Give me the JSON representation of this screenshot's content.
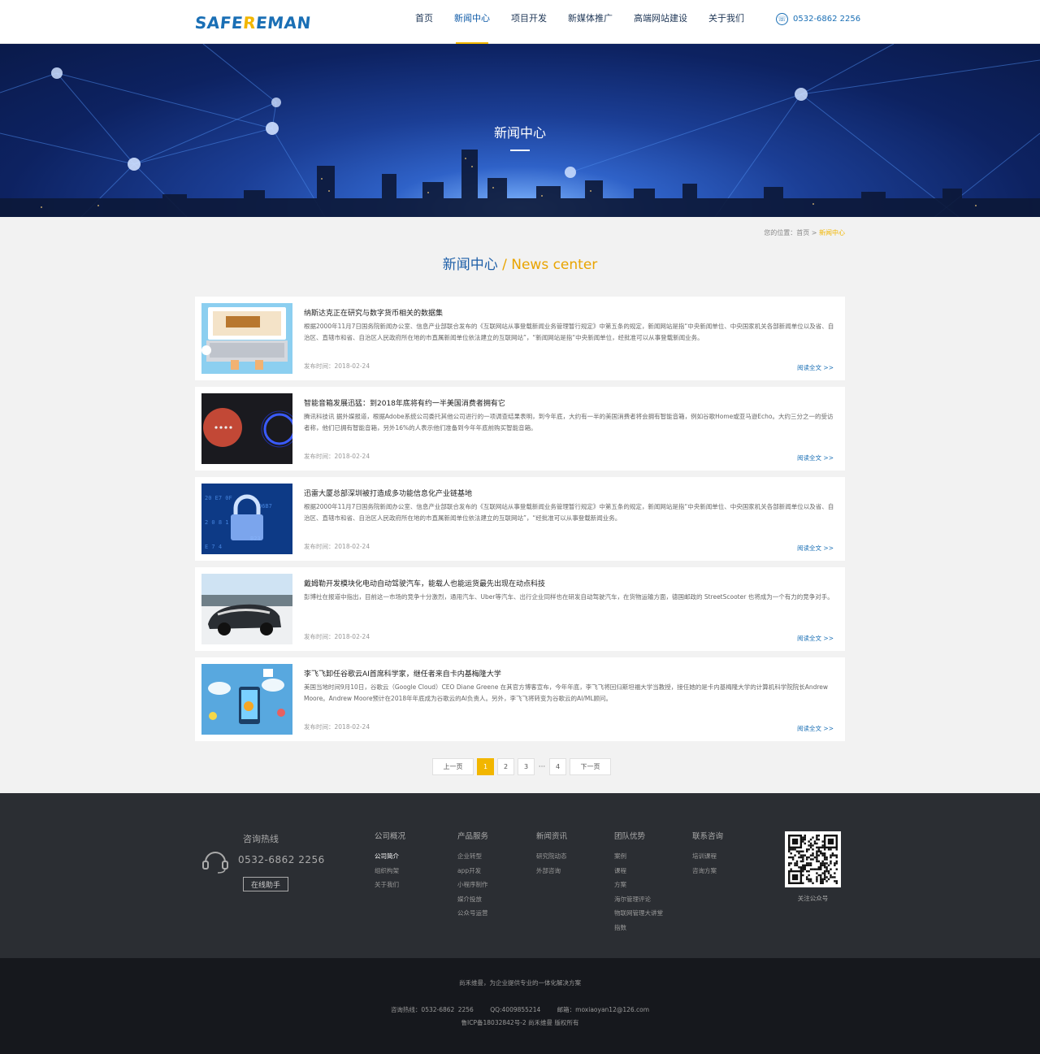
{
  "header": {
    "logo_left": "SAFE",
    "logo_key": "R",
    "logo_right": "EMAN",
    "nav": [
      "首页",
      "新闻中心",
      "项目开发",
      "新媒体推广",
      "高端网站建设",
      "关于我们"
    ],
    "active_nav": 1,
    "phone": "0532-6862 2256"
  },
  "banner": {
    "title": "新闻中心"
  },
  "breadcrumb": {
    "prefix": "您的位置：",
    "home": "首页",
    "sep": " > ",
    "current": "新闻中心"
  },
  "section": {
    "title_cn": "新闻中心",
    "sep": " / ",
    "title_en": "News center"
  },
  "news": [
    {
      "title": "纳斯达克正在研究与数字货币相关的数据集",
      "summary": "根据2000年11月7日国务院新闻办公室、信息产业部联合发布的《互联网站从事登载新闻业务管理暂行规定》中第五条的规定，新闻网站是指“中央新闻单位、中央国家机关各部新闻单位以及省、自治区、直辖市和省、自治区人民政府所在地的市直属新闻单位依法建立的互联网站”，“新闻网站是指“中央新闻单位，经批准可以从事登载新闻业务。",
      "date": "发布时间：2018-02-24",
      "more": "阅读全文 >>",
      "thumb": "laptop"
    },
    {
      "title": "智能音箱发展迅猛：到2018年底将有约一半美国消费者拥有它",
      "summary": "腾讯科技讯 据外媒报道，根据Adobe系统公司委托其他公司进行的一项调查结果表明，到今年底，大约有一半的美国消费者将会拥有智能音箱，例如谷歌Home或亚马逊Echo。大约三分之一的受访者称，他们已拥有智能音箱，另外16%的人表示他们准备到今年年底前购买智能音箱。",
      "date": "发布时间：2018-02-24",
      "more": "阅读全文 >>",
      "thumb": "speaker"
    },
    {
      "title": "迅雷大厦总部深圳被打造成多功能信息化产业链基地",
      "summary": "根据2000年11月7日国务院新闻办公室、信息产业部联合发布的《互联网站从事登载新闻业务管理暂行规定》中第五条的规定，新闻网站是指“中央新闻单位、中央国家机关各部新闻单位以及省、自治区、直辖市和省、自治区人民政府所在地的市直属新闻单位依法建立的互联网站”，“经批准可以从事登载新闻业务。",
      "date": "发布时间：2018-02-24",
      "more": "阅读全文 >>",
      "thumb": "lock"
    },
    {
      "title": "戴姆勒开发模块化电动自动驾驶汽车，能载人也能运货最先出现在动点科技",
      "summary": "彭博社在报道中指出，目前这一市场的竞争十分激烈，通用汽车、Uber等汽车、出行企业同样也在研发自动驾驶汽车，在货物运输方面，德国邮政的 StreetScooter 也将成为一个有力的竞争对手。",
      "date": "发布时间：2018-02-24",
      "more": "阅读全文 >>",
      "thumb": "car"
    },
    {
      "title": "李飞飞卸任谷歌云AI首席科学家，继任者来自卡内基梅隆大学",
      "summary": "美国当地时间9月10日，谷歌云（Google Cloud）CEO Diane Greene 在其官方博客宣布，今年年底，李飞飞将回归斯坦福大学当教授，接任她的是卡内基梅隆大学的计算机科学院院长Andrew Moore。Andrew Moore预计在2018年年底成为谷歌云的AI负责人。另外，李飞飞将转变为谷歌云的AI/ML顾问。",
      "date": "发布时间：2018-02-24",
      "more": "阅读全文 >>",
      "thumb": "phone"
    }
  ],
  "pagination": {
    "prev": "上一页",
    "pages": [
      "1",
      "2",
      "3"
    ],
    "dots": "···",
    "last": "4",
    "next": "下一页",
    "current": "1"
  },
  "footer": {
    "hotline_title": "咨询热线",
    "hotline_number": "0532-6862 2256",
    "online_btn": "在线助手",
    "columns": [
      {
        "title": "公司概况",
        "items": [
          "公司简介",
          "组织构架",
          "关于我们"
        ],
        "highlight": 0
      },
      {
        "title": "产品服务",
        "items": [
          "企业转型",
          "app开发",
          "小程序制作",
          "媒介投放",
          "公众号运营"
        ]
      },
      {
        "title": "新闻资讯",
        "items": [
          "研究院动态",
          "外部咨询"
        ]
      },
      {
        "title": "团队优势",
        "items": [
          "案例",
          "课程",
          "方案",
          "海尔管理评论",
          "物联网管理大讲堂",
          "指数"
        ]
      },
      {
        "title": "联系咨询",
        "items": [
          "培训课程",
          "咨询方案"
        ]
      }
    ],
    "qr_label": "关注公众号"
  },
  "bottom": {
    "slogan": "尚禾维曼，为企业提供专业的一体化解决方案",
    "hotline": "咨询热线：0532-6862 2256",
    "qq": "QQ:4009855214",
    "email": "邮箱：moxiaoyan12@126.com",
    "icp": "鲁ICP备18032842号-2  尚禾维曼 版权所有"
  },
  "colors": {
    "brand_blue": "#1a6fb5",
    "accent_yellow": "#f2b600",
    "footer_bg": "#2b2e33",
    "bottom_bg": "#16181d"
  }
}
